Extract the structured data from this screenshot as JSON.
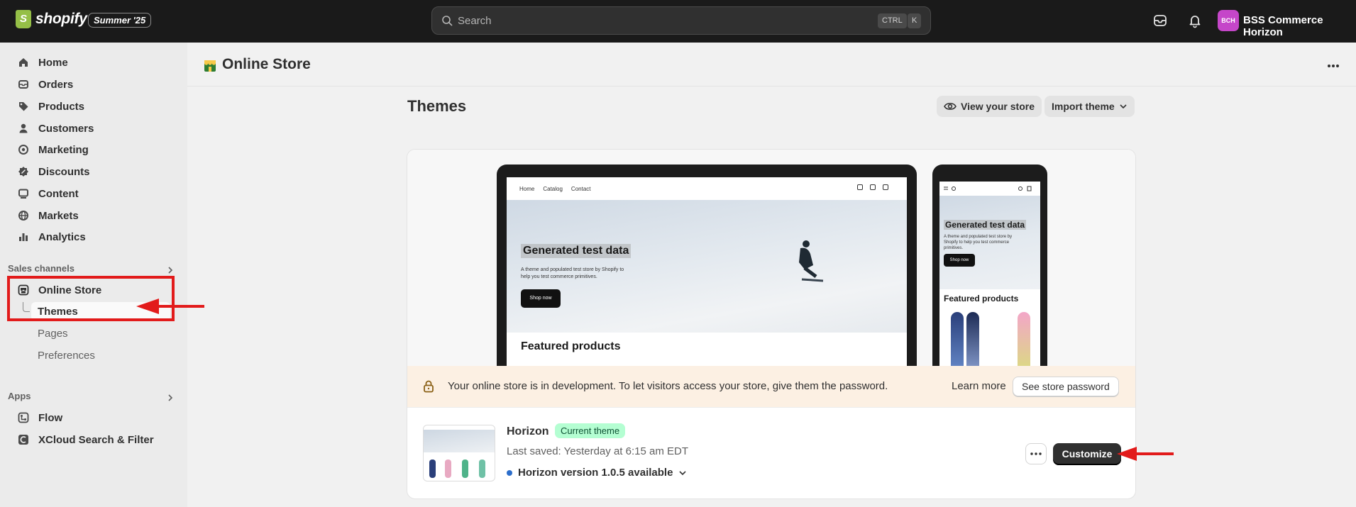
{
  "topbar": {
    "logo_text": "shopify",
    "edition": "Summer '25",
    "search_placeholder": "Search",
    "kbd_ctrl": "CTRL",
    "kbd_k": "K",
    "avatar_initials": "BCH",
    "store_name": "BSS Commerce Horizon"
  },
  "sidebar": {
    "items": [
      {
        "label": "Home",
        "icon": "home-icon"
      },
      {
        "label": "Orders",
        "icon": "orders-icon"
      },
      {
        "label": "Products",
        "icon": "tag-icon"
      },
      {
        "label": "Customers",
        "icon": "person-icon"
      },
      {
        "label": "Marketing",
        "icon": "target-icon"
      },
      {
        "label": "Discounts",
        "icon": "discount-icon"
      },
      {
        "label": "Content",
        "icon": "content-icon"
      },
      {
        "label": "Markets",
        "icon": "globe-icon"
      },
      {
        "label": "Analytics",
        "icon": "bar-chart-icon"
      }
    ],
    "sales_channels_heading": "Sales channels",
    "online_store": "Online Store",
    "sub_items": [
      "Themes",
      "Pages",
      "Preferences"
    ],
    "apps_heading": "Apps",
    "apps": [
      "Flow",
      "XCloud Search & Filter"
    ]
  },
  "page": {
    "title": "Online Store",
    "section_title": "Themes",
    "view_store": "View your store",
    "import_theme": "Import theme"
  },
  "preview": {
    "nav": [
      "Home",
      "Catalog",
      "Contact"
    ],
    "hero_title": "Generated test data",
    "hero_sub": "A theme and populated test store by Shopify to help you test commerce primitives.",
    "hero_button": "Shop now",
    "featured": "Featured products"
  },
  "banner": {
    "text": "Your online store is in development. To let visitors access your store, give them the password.",
    "learn_more": "Learn more",
    "password_button": "See store password"
  },
  "theme": {
    "name": "Horizon",
    "badge": "Current theme",
    "last_saved": "Last saved: Yesterday at 6:15 am EDT",
    "version": "Horizon version 1.0.5 available",
    "customize": "Customize"
  },
  "colors": {
    "topbar": "#1a1a1a",
    "annotation": "#e21b1b",
    "badge_bg": "#b4fed2",
    "banner_bg": "#fcf0e3"
  }
}
